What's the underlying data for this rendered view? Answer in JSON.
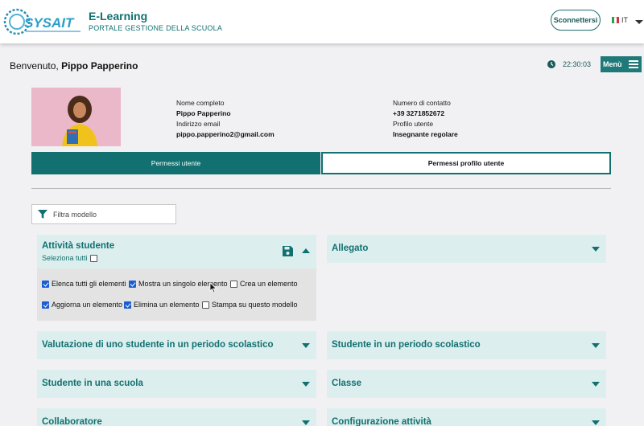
{
  "header": {
    "logo_text": "SYSAIT",
    "app_title": "E-Learning",
    "app_subtitle": "PORTALE GESTIONE DELLA SCUOLA",
    "logout_label": "Sconnettersi",
    "language": "IT"
  },
  "welcome": {
    "greeting": "Benvenuto,",
    "user_name": "Pippo Papperino"
  },
  "clock": "22:30:03",
  "menu_label": "Menù",
  "profile": {
    "full_name_label": "Nome completo",
    "full_name": "Pippo Papperino",
    "email_label": "Indirizzo email",
    "email": "pippo.papperino2@gmail.com",
    "contact_label": "Numero di contatto",
    "contact": "+39 3271852672",
    "role_label": "Profilo utente",
    "role": "Insegnante regolare"
  },
  "tabs": [
    {
      "label": "Permessi utente",
      "active": true
    },
    {
      "label": "Permessi profilo utente",
      "active": false
    }
  ],
  "filter": {
    "placeholder": "Filtra modello"
  },
  "panels": {
    "attivita": {
      "title": "Attività studente",
      "select_all": "Seleziona tutti",
      "permissions": [
        {
          "label": "Elenca tutti gli elementi",
          "checked": true
        },
        {
          "label": "Mostra un singolo elemento",
          "checked": true
        },
        {
          "label": "Crea un elemento",
          "checked": false
        },
        {
          "label": "Aggiorna un elemento",
          "checked": true
        },
        {
          "label": "Elimina un elemento",
          "checked": true
        },
        {
          "label": "Stampa su questo modello",
          "checked": false
        }
      ]
    },
    "allegato": "Allegato",
    "valutazione": "Valutazione di uno studente in un periodo scolastico",
    "studente_periodo": "Studente in un periodo scolastico",
    "studente_scuola": "Studente in una scuola",
    "classe": "Classe",
    "collaboratore": "Collaboratore",
    "configurazione": "Configurazione attività"
  },
  "colors": {
    "accent": "#127070",
    "panel_bg": "#dcefee",
    "checkbox_checked": "#1a5fd0"
  }
}
